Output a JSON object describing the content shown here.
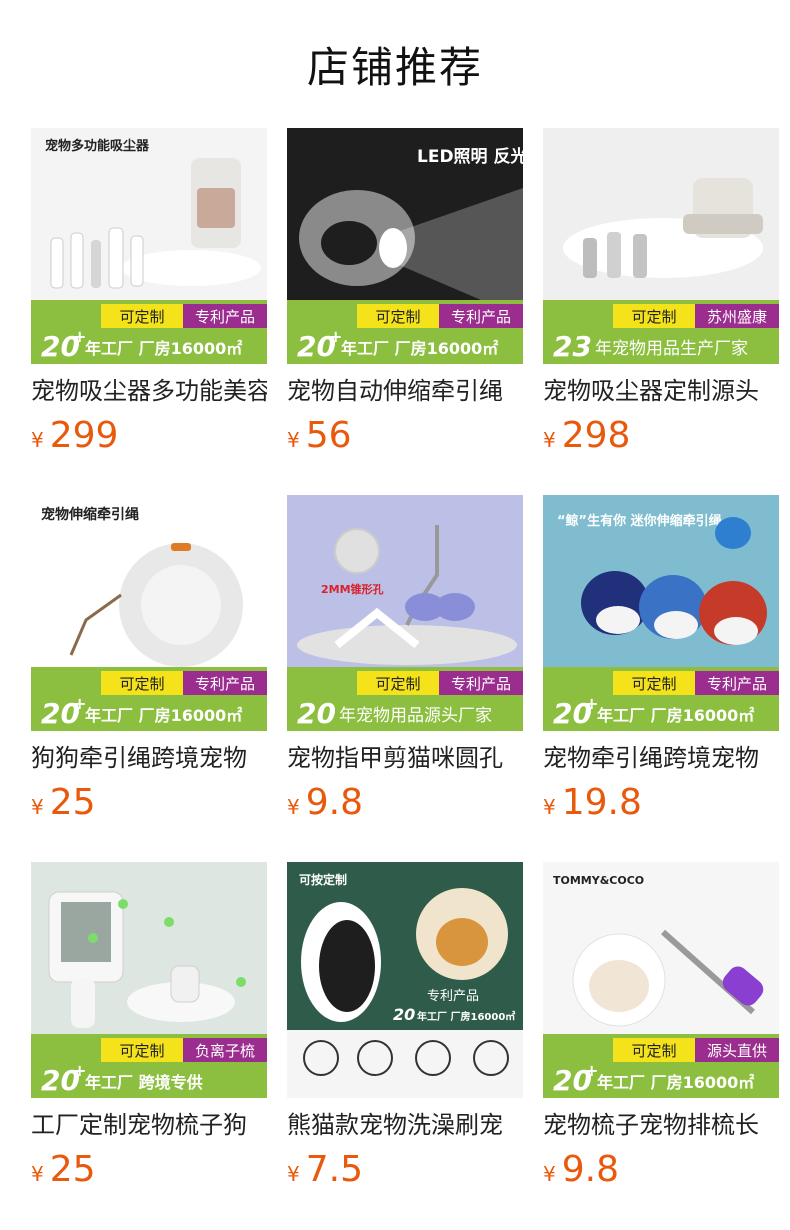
{
  "page": {
    "title": "店铺推荐"
  },
  "products": [
    {
      "name": "宠物吸尘器多功能美容",
      "currency": "¥",
      "price": "299",
      "image_text": {
        "headline": "宠物多功能吸尘器",
        "badge_custom": "可定制",
        "badge_right": "专利产品",
        "number": "20",
        "banner": "年工厂 厂房16000㎡"
      }
    },
    {
      "name": "宠物自动伸缩牵引绳",
      "currency": "¥",
      "price": "56",
      "image_text": {
        "headline": "LED照明 反光织带",
        "badge_custom": "可定制",
        "badge_right": "专利产品",
        "number": "20",
        "banner": "年工厂 厂房16000㎡"
      }
    },
    {
      "name": "宠物吸尘器定制源头",
      "currency": "¥",
      "price": "298",
      "image_text": {
        "headline": "",
        "badge_custom": "可定制",
        "badge_right": "苏州盛康",
        "number": "23",
        "banner": "年宠物用品生产厂家"
      }
    },
    {
      "name": "狗狗牵引绳跨境宠物",
      "currency": "¥",
      "price": "25",
      "image_text": {
        "headline": "宠物伸缩牵引绳",
        "badge_custom": "可定制",
        "badge_right": "专利产品",
        "number": "20",
        "banner": "年工厂 厂房16000㎡"
      }
    },
    {
      "name": "宠物指甲剪猫咪圆孔",
      "currency": "¥",
      "price": "9.8",
      "image_text": {
        "headline": "2MM锥形孔",
        "badge_custom": "可定制",
        "badge_right": "专利产品",
        "number": "20",
        "banner": "年宠物用品源头厂家"
      }
    },
    {
      "name": "宠物牵引绳跨境宠物",
      "currency": "¥",
      "price": "19.8",
      "image_text": {
        "headline": "“鲸”生有你 迷你伸缩牵引绳",
        "badge_custom": "可定制",
        "badge_right": "专利产品",
        "number": "20",
        "banner": "年工厂 厂房16000㎡"
      }
    },
    {
      "name": "工厂定制宠物梳子狗",
      "currency": "¥",
      "price": "25",
      "image_text": {
        "headline": "",
        "badge_custom": "可定制",
        "badge_right": "负离子梳",
        "number": "20",
        "banner": "年工厂 跨境专供"
      }
    },
    {
      "name": "熊猫款宠物洗澡刷宠",
      "currency": "¥",
      "price": "7.5",
      "image_text": {
        "headline": "可按定制",
        "badge_custom": "",
        "badge_right": "专利产品",
        "number": "20",
        "banner": "年工厂 厂房16000㎡"
      }
    },
    {
      "name": "宠物梳子宠物排梳长",
      "currency": "¥",
      "price": "9.8",
      "image_text": {
        "headline": "TOMMY&COCO",
        "badge_custom": "可定制",
        "badge_right": "源头直供",
        "number": "20",
        "banner": "年工厂 厂房16000㎡"
      }
    }
  ]
}
